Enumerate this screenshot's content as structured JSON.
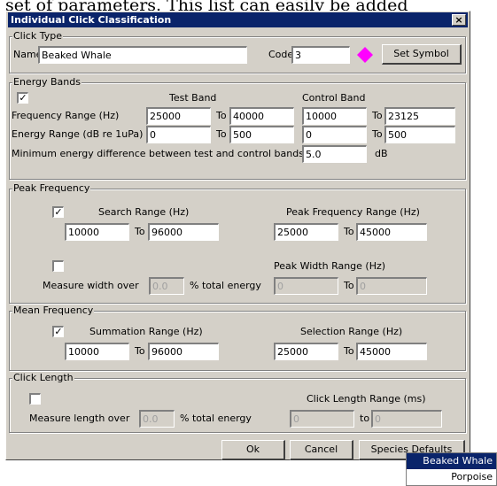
{
  "caption": "set of parameters.  This list can easily be added",
  "window": {
    "title": "Individual Click Classification",
    "close_glyph": "×"
  },
  "click_type": {
    "legend": "Click Type",
    "name_label": "Name",
    "name_value": "Beaked Whale",
    "code_label": "Code",
    "code_value": "3",
    "symbol_color": "#ff00ff",
    "set_symbol_label": "Set Symbol"
  },
  "energy_bands": {
    "legend": "Energy Bands",
    "enabled_check": "✓",
    "test_band_label": "Test Band",
    "control_band_label": "Control Band",
    "freq_range_label": "Frequency Range (Hz)",
    "freq_test_from": "25000",
    "to1": "To",
    "freq_test_to": "40000",
    "freq_ctrl_from": "10000",
    "to2": "To",
    "freq_ctrl_to": "23125",
    "energy_range_label": "Energy Range (dB re 1uPa)",
    "energy_test_from": "0",
    "to3": "To",
    "energy_test_to": "500",
    "energy_ctrl_from": "0",
    "to4": "To",
    "energy_ctrl_to": "500",
    "min_diff_label": "Minimum energy difference between test and control bands",
    "min_diff_value": "5.0",
    "min_diff_unit": "dB"
  },
  "peak_frequency": {
    "legend": "Peak Frequency",
    "search_check": "✓",
    "search_label": "Search Range (Hz)",
    "search_from": "10000",
    "to1": "To",
    "search_to": "96000",
    "peak_range_label": "Peak Frequency Range (Hz)",
    "peak_from": "25000",
    "to2": "To",
    "peak_to": "45000",
    "width_check": "",
    "peak_width_label": "Peak Width Range (Hz)",
    "measure_label": "Measure width over",
    "measure_value": "0.0",
    "measure_unit": "% total energy",
    "width_from": "0",
    "to3": "To",
    "width_to": "0"
  },
  "mean_frequency": {
    "legend": "Mean Frequency",
    "summation_check": "✓",
    "summation_label": "Summation Range (Hz)",
    "sum_from": "10000",
    "to1": "To",
    "sum_to": "96000",
    "selection_label": "Selection Range (Hz)",
    "sel_from": "25000",
    "to2": "To",
    "sel_to": "45000"
  },
  "click_length": {
    "legend": "Click Length",
    "length_check": "",
    "range_label": "Click Length Range (ms)",
    "measure_label": "Measure length over",
    "measure_value": "0.0",
    "measure_unit": "% total energy",
    "len_from": "0",
    "to1": "to",
    "len_to": "0"
  },
  "buttons": {
    "ok": "Ok",
    "cancel": "Cancel",
    "species_defaults": "Species Defaults"
  },
  "species_menu": {
    "items": [
      "Beaked Whale",
      "Porpoise"
    ],
    "selected": "Beaked Whale"
  }
}
